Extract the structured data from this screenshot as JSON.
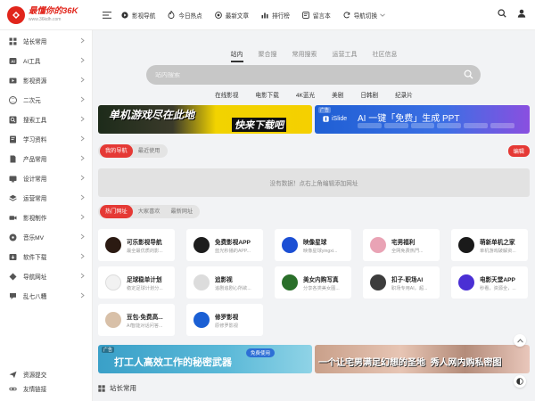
{
  "logo": {
    "title": "最懂你的36K",
    "url": "www.36kdh.com"
  },
  "topnav": [
    {
      "label": "影视导航",
      "icon": "play-icon"
    },
    {
      "label": "今日热点",
      "icon": "fire-icon"
    },
    {
      "label": "最新文章",
      "icon": "record-icon"
    },
    {
      "label": "排行榜",
      "icon": "chart-icon"
    },
    {
      "label": "留言本",
      "icon": "message-icon"
    },
    {
      "label": "导航切换",
      "icon": "switch-icon"
    }
  ],
  "sidebar": {
    "items": [
      {
        "label": "站长常用",
        "icon": "grid-icon"
      },
      {
        "label": "AI工具",
        "icon": "ai-icon"
      },
      {
        "label": "影视资源",
        "icon": "film-icon"
      },
      {
        "label": "二次元",
        "icon": "anime-icon"
      },
      {
        "label": "搜索工具",
        "icon": "search-icon"
      },
      {
        "label": "学习资料",
        "icon": "book-icon"
      },
      {
        "label": "产品常用",
        "icon": "doc-icon"
      },
      {
        "label": "设计常用",
        "icon": "design-icon"
      },
      {
        "label": "运营常用",
        "icon": "layers-icon"
      },
      {
        "label": "影视制作",
        "icon": "camera-icon"
      },
      {
        "label": "音乐MV",
        "icon": "music-icon"
      },
      {
        "label": "软件下载",
        "icon": "software-icon"
      },
      {
        "label": "导航网址",
        "icon": "nav-icon"
      },
      {
        "label": "乱七八糟",
        "icon": "misc-icon"
      }
    ],
    "bottom": [
      {
        "label": "资源提交",
        "icon": "send-icon"
      },
      {
        "label": "友情链接",
        "icon": "link-icon"
      }
    ]
  },
  "search": {
    "tabs": [
      "站内",
      "聚合搜",
      "常用搜索",
      "运营工具",
      "社区信息"
    ],
    "active_tab": "站内",
    "placeholder": "站内搜索",
    "options": [
      "在线影视",
      "电影下载",
      "4K蓝光",
      "美剧",
      "日韩剧",
      "纪录片"
    ]
  },
  "banners": {
    "left": {
      "text": "单机游戏尽在此地",
      "button": "快来下载吧"
    },
    "right": {
      "tag": "广告",
      "brand": "iSlide",
      "text": "AI 一键「免费」生成 PPT"
    }
  },
  "mysites": {
    "tabs": [
      "我的导航",
      "最近使用"
    ],
    "edit_label": "编辑",
    "empty_text": "没有数据！点右上角编辑添加网址"
  },
  "hot": {
    "tabs": [
      "热门网址",
      "大家喜欢",
      "最新网址"
    ],
    "cards": [
      {
        "title": "可乐影视导航",
        "desc": "最全最优质的影...",
        "color": "#2b1a12"
      },
      {
        "title": "免费影视APP",
        "desc": "蓝光秒播的APP...",
        "color": "#1d1d1d"
      },
      {
        "title": "映像星球",
        "desc": "映像星球yingxi...",
        "color": "#1c4fd4"
      },
      {
        "title": "宅男福利",
        "desc": "全网免费热門...",
        "color": "#e9a3b5"
      },
      {
        "title": "萌新单机之家",
        "desc": "单机游戏破解资...",
        "color": "#1a1a1a"
      },
      {
        "title": "足球稳单计划",
        "desc": "稳定足球计划分...",
        "color": "#f2f2f2"
      },
      {
        "title": "追影视",
        "desc": "追剧追剧心所欲...",
        "color": "#dcdcdc"
      },
      {
        "title": "美女内购写真",
        "desc": "分享各类美女图...",
        "color": "#2a6f2a"
      },
      {
        "title": "扣子-职场AI",
        "desc": "职场专用AI，超...",
        "color": "#3d3d3d"
      },
      {
        "title": "电影天堂APP",
        "desc": "秒看，资源全，...",
        "color": "#4a2fd4"
      },
      {
        "title": "豆包-免费高...",
        "desc": "AI智能对话问答...",
        "color": "#d8c0a8"
      },
      {
        "title": "修罗影视",
        "desc": "原修罗影视",
        "color": "#1a5fd4"
      }
    ]
  },
  "ads": {
    "left": {
      "tag": "广告",
      "text": "打工人高效工作的秘密武器",
      "button": "免费使用"
    },
    "right": {
      "text": "一个让宅男满足幻想的圣地",
      "text2": "秀人网内购私密图"
    }
  },
  "section_title": "站长常用",
  "colors": {
    "accent": "#e53935",
    "brand": "#e1251b"
  }
}
